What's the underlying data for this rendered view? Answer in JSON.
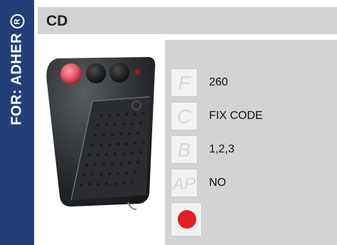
{
  "sidebar": {
    "text": "FOR: ADHER",
    "registered_mark": "R"
  },
  "header": {
    "title": "CD"
  },
  "specs": [
    {
      "letter": "F",
      "value": "260"
    },
    {
      "letter": "C",
      "value": "FIX CODE"
    },
    {
      "letter": "B",
      "value": "1,2,3"
    },
    {
      "letter": "AP",
      "value": "NO"
    }
  ],
  "button_color": {
    "color": "#e31e24"
  },
  "colors": {
    "band": "#243f77",
    "panel": "#d1d3d4",
    "accent_red": "#e31e24"
  }
}
